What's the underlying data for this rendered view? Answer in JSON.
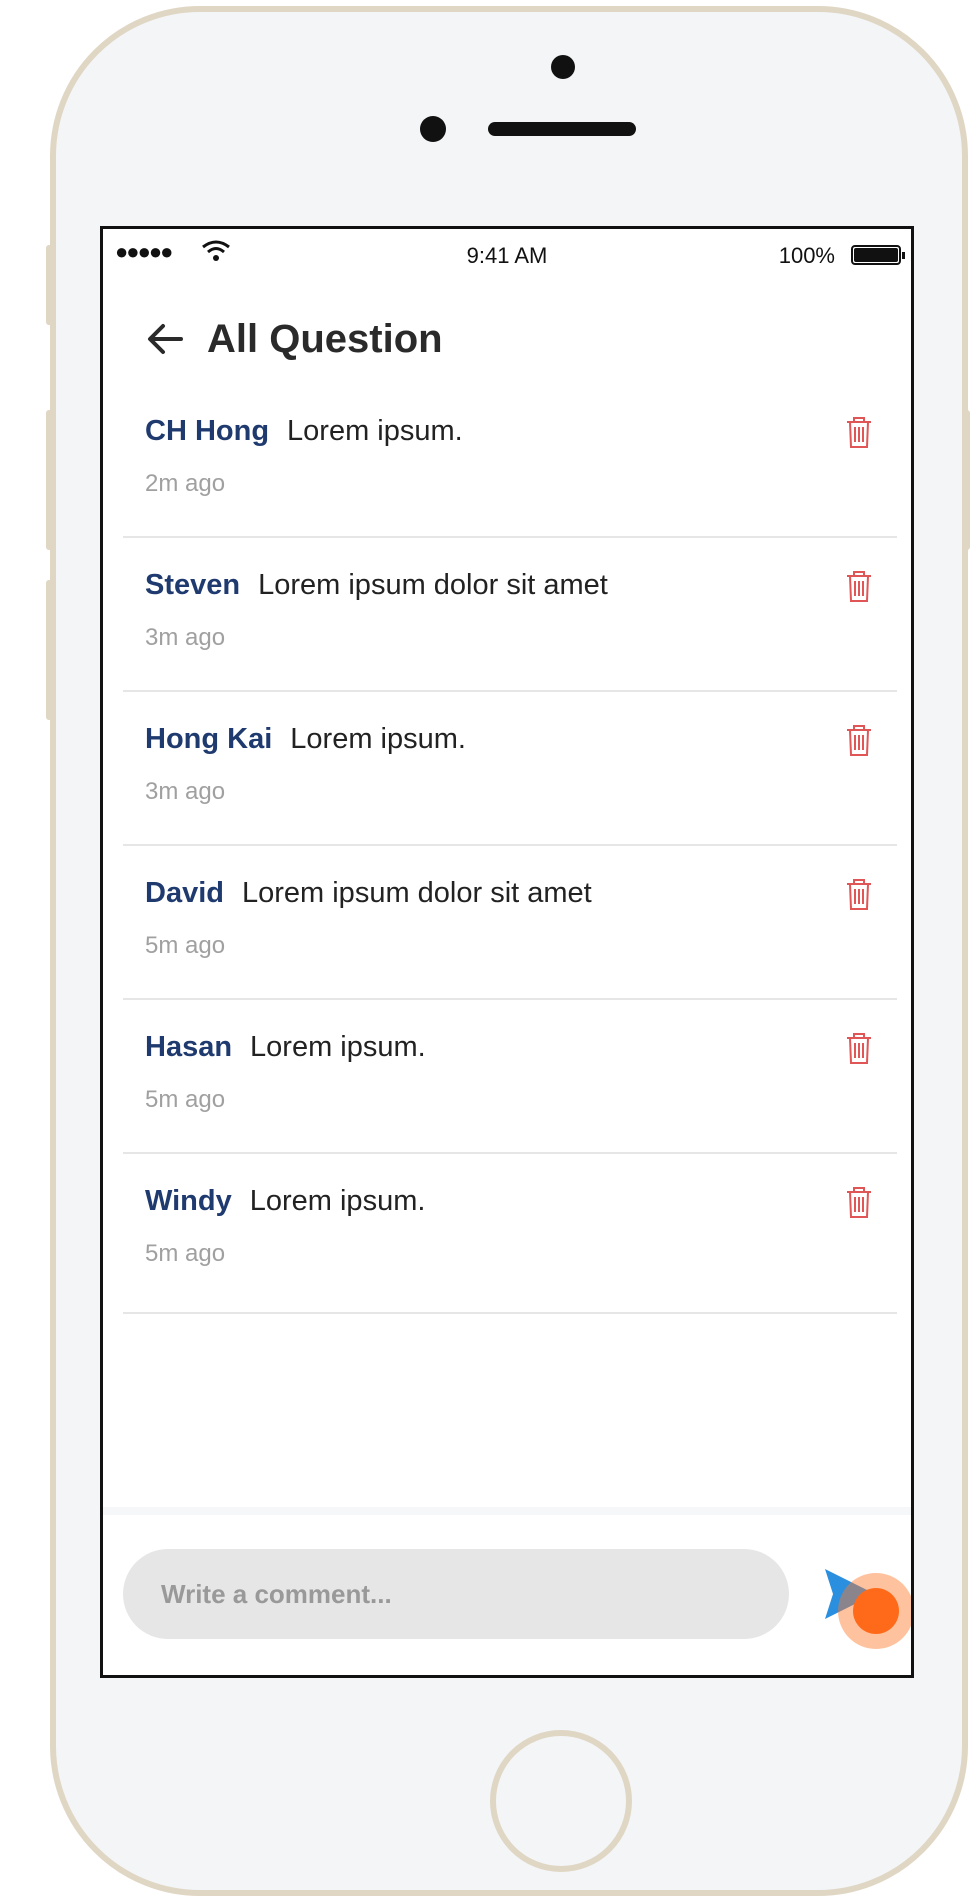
{
  "status_bar": {
    "signal": "●●●●●",
    "time": "9:41 AM",
    "battery": "100%"
  },
  "header": {
    "title": "All Question"
  },
  "questions": [
    {
      "author": "CH Hong",
      "text": "Lorem ipsum.",
      "time": "2m ago"
    },
    {
      "author": "Steven",
      "text": "Lorem ipsum dolor sit amet",
      "time": "3m ago"
    },
    {
      "author": "Hong Kai",
      "text": "Lorem ipsum.",
      "time": "3m ago"
    },
    {
      "author": "David",
      "text": "Lorem ipsum dolor sit amet",
      "time": "5m ago"
    },
    {
      "author": "Hasan",
      "text": "Lorem ipsum.",
      "time": "5m ago"
    },
    {
      "author": "Windy",
      "text": "Lorem ipsum.",
      "time": "5m ago"
    }
  ],
  "comment": {
    "placeholder": "Write a comment..."
  },
  "colors": {
    "author": "#1f3a6e",
    "delete": "#e05555",
    "send": "#2b8fe0",
    "tap_indicator": "#ff6a1a"
  }
}
